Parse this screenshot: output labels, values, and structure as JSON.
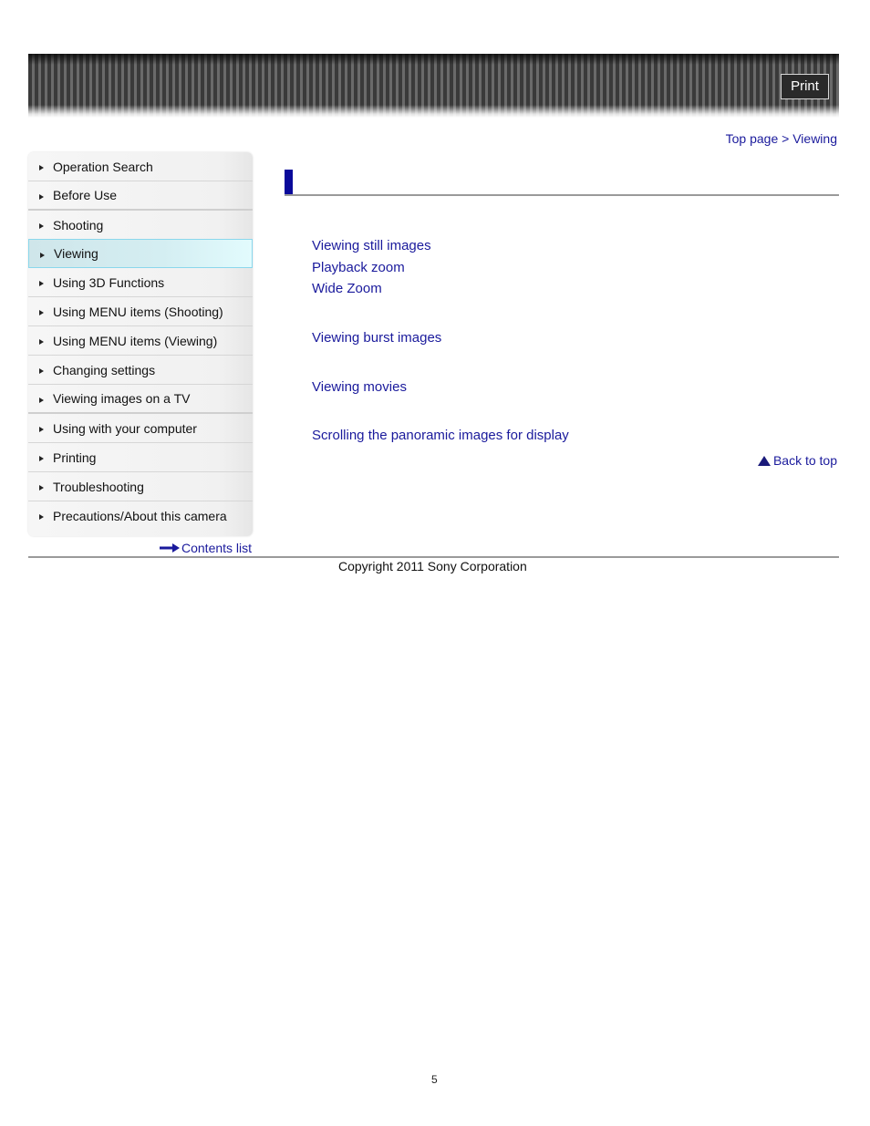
{
  "header": {
    "print_label": "Print"
  },
  "breadcrumb": {
    "text": "Top page > Viewing",
    "items": [
      "Top page",
      "Viewing"
    ]
  },
  "sidebar": {
    "items": [
      {
        "label": "Operation Search",
        "active": false
      },
      {
        "label": "Before Use",
        "active": false
      },
      {
        "label": "Shooting",
        "active": false
      },
      {
        "label": "Viewing",
        "active": true
      },
      {
        "label": "Using 3D Functions",
        "active": false
      },
      {
        "label": "Using MENU items (Shooting)",
        "active": false
      },
      {
        "label": "Using MENU items (Viewing)",
        "active": false
      },
      {
        "label": "Changing settings",
        "active": false
      },
      {
        "label": "Viewing images on a TV",
        "active": false
      },
      {
        "label": "Using with your computer",
        "active": false
      },
      {
        "label": "Printing",
        "active": false
      },
      {
        "label": "Troubleshooting",
        "active": false
      },
      {
        "label": "Precautions/About this camera",
        "active": false
      }
    ],
    "contents_list_label": "Contents list"
  },
  "main": {
    "links": [
      "Viewing still images",
      "Playback zoom",
      "Wide Zoom",
      "Viewing burst images",
      "Viewing movies",
      "Scrolling the panoramic images for display"
    ],
    "back_to_top_label": "Back to top"
  },
  "footer": {
    "copyright": "Copyright 2011 Sony Corporation",
    "page_number": "5"
  },
  "colors": {
    "link": "#1a1a9c",
    "title_accent": "#0a0a9a",
    "active_border": "#8ad7ec"
  }
}
